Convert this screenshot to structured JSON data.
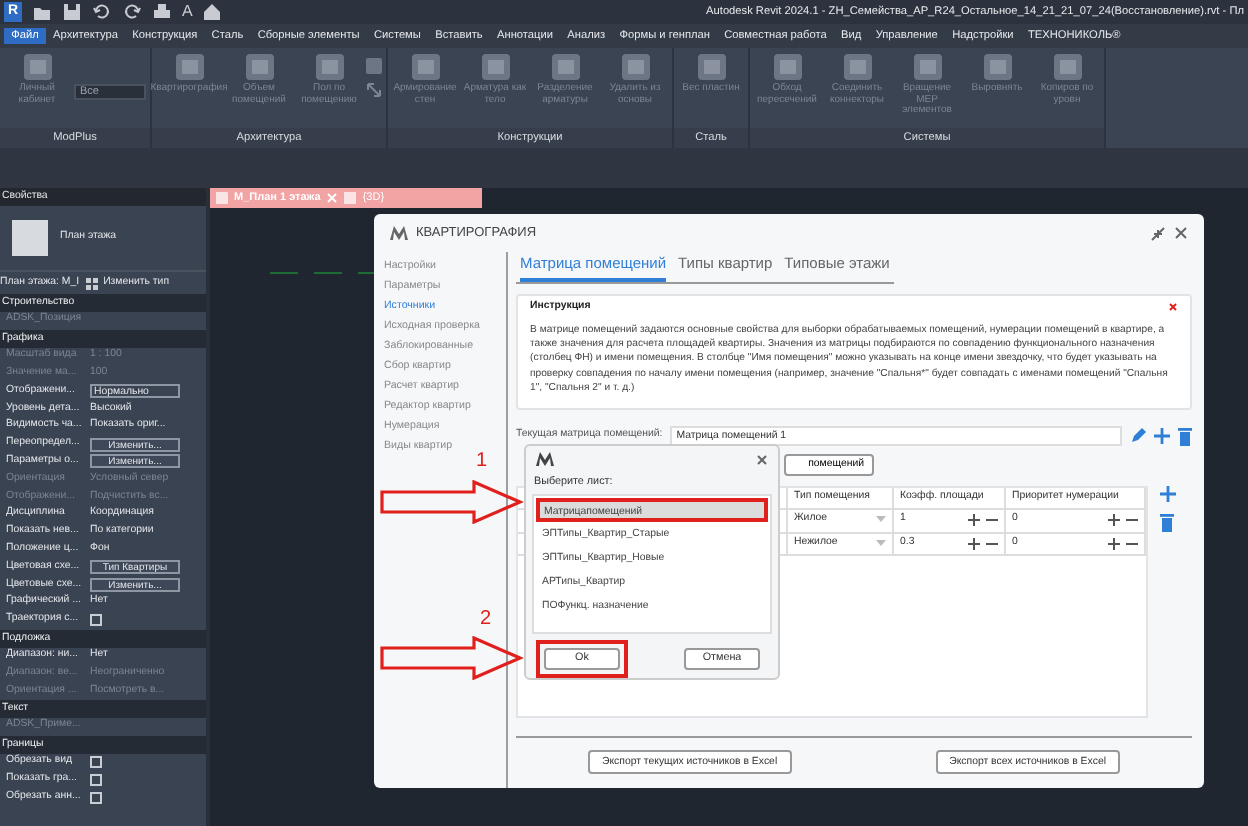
{
  "title_bar": {
    "logo": "R",
    "text_tool": "A",
    "title": "Autodesk Revit 2024.1 - ZH_Семейства_АР_R24_Остальное_14_21_21_07_24(Восстановление).rvt - Пл"
  },
  "menu": [
    {
      "label": "Файл",
      "selected": true
    },
    {
      "label": "Архитектура",
      "selected": false
    },
    {
      "label": "Конструкция",
      "selected": false
    },
    {
      "label": "Сталь",
      "selected": false
    },
    {
      "label": "Сборные элементы",
      "selected": false
    },
    {
      "label": "Системы",
      "selected": false
    },
    {
      "label": "Вставить",
      "selected": false
    },
    {
      "label": "Аннотации",
      "selected": false
    },
    {
      "label": "Анализ",
      "selected": false
    },
    {
      "label": "Формы и генплан",
      "selected": false
    },
    {
      "label": "Совместная работа",
      "selected": false
    },
    {
      "label": "Вид",
      "selected": false
    },
    {
      "label": "Управление",
      "selected": false
    },
    {
      "label": "Надстройки",
      "selected": false
    },
    {
      "label": "ТЕХНОНИКОЛЬ®",
      "selected": false
    }
  ],
  "ribbon": [
    {
      "title": "ModPlus",
      "tools": [
        {
          "kind": "large",
          "label": "Личный кабинет"
        },
        {
          "kind": "combo",
          "label": "Все"
        }
      ]
    },
    {
      "title": "Архитектура",
      "tools": [
        {
          "kind": "large",
          "label": "Квартирография"
        },
        {
          "kind": "large",
          "label": "Объем помещений"
        },
        {
          "kind": "large",
          "label": "Пол по помещению"
        },
        {
          "kind": "small"
        }
      ]
    },
    {
      "title": "Конструкции",
      "tools": [
        {
          "kind": "large",
          "label": "Армирование стен"
        },
        {
          "kind": "large",
          "label": "Арматура как тело"
        },
        {
          "kind": "large",
          "label": "Разделение арматуры"
        },
        {
          "kind": "large",
          "label": "Удалить из основы"
        }
      ]
    },
    {
      "title": "Сталь",
      "tools": [
        {
          "kind": "large",
          "label": "Вес пластин"
        }
      ]
    },
    {
      "title": "Системы",
      "tools": [
        {
          "kind": "large",
          "label": "Обход пересечений"
        },
        {
          "kind": "large",
          "label": "Соединить коннекторы"
        },
        {
          "kind": "large",
          "label": "Вращение MEP элементов"
        },
        {
          "kind": "large",
          "label": "Выровнять"
        },
        {
          "kind": "large",
          "label": "Копиров по уровн"
        }
      ]
    }
  ],
  "properties": {
    "title": "Свойства",
    "type_name": "План этажа",
    "view_selector": "План этажа: M_I",
    "edit_type": "Изменить тип",
    "groups": [
      {
        "title": "Строительство",
        "rows": [
          {
            "kind": "text",
            "label": "ADSK_Позиция",
            "disabled": true
          }
        ]
      },
      {
        "title": "Графика",
        "rows": [
          {
            "kind": "text",
            "label": "Масштаб вида",
            "value": "1 : 100",
            "disabled": true
          },
          {
            "kind": "text",
            "label": "Значение ма...",
            "value": "100",
            "disabled": true
          },
          {
            "kind": "field",
            "label": "Отображени...",
            "value": "Нормально",
            "disabled": false
          },
          {
            "kind": "text",
            "label": "Уровень дета...",
            "value": "Высокий",
            "disabled": false
          },
          {
            "kind": "text",
            "label": "Видимость ча...",
            "value": "Показать ориг...",
            "disabled": false
          },
          {
            "kind": "button",
            "label": "Переопредел...",
            "value": "Изменить...",
            "disabled": false
          },
          {
            "kind": "button",
            "label": "Параметры о...",
            "value": "Изменить...",
            "disabled": false
          },
          {
            "kind": "text",
            "label": "Ориентация",
            "value": "Условный север",
            "disabled": true
          },
          {
            "kind": "text",
            "label": "Отображени...",
            "value": "Подчистить вс...",
            "disabled": true
          },
          {
            "kind": "text",
            "label": "Дисциплина",
            "value": "Координация",
            "disabled": false
          },
          {
            "kind": "text",
            "label": "Показать нев...",
            "value": "По категории",
            "disabled": false
          },
          {
            "kind": "text",
            "label": "Положение ц...",
            "value": "Фон",
            "disabled": false
          },
          {
            "kind": "button",
            "label": "Цветовая схе...",
            "value": "Тип Квартиры",
            "disabled": false
          },
          {
            "kind": "button",
            "label": "Цветовые схе...",
            "value": "Изменить...",
            "disabled": false
          },
          {
            "kind": "text",
            "label": "Графический ...",
            "value": "Нет",
            "disabled": false
          },
          {
            "kind": "check",
            "label": "Траектория с...",
            "checked": false,
            "disabled": false
          }
        ]
      },
      {
        "title": "Подложка",
        "rows": [
          {
            "kind": "text",
            "label": "Диапазон: ни...",
            "value": "Нет",
            "disabled": false
          },
          {
            "kind": "text",
            "label": "Диапазон: ве...",
            "value": "Неограниченно",
            "disabled": true
          },
          {
            "kind": "text",
            "label": "Ориентация ...",
            "value": "Посмотреть в...",
            "disabled": true
          }
        ]
      },
      {
        "title": "Текст",
        "rows": [
          {
            "kind": "text",
            "label": "ADSK_Приме...",
            "disabled": true
          }
        ]
      },
      {
        "title": "Границы",
        "rows": [
          {
            "kind": "check",
            "label": "Обрезать вид",
            "checked": false,
            "disabled": false
          },
          {
            "kind": "check",
            "label": "Показать гра...",
            "checked": false,
            "disabled": false
          },
          {
            "kind": "check",
            "label": "Обрезать анн...",
            "checked": false,
            "disabled": false
          }
        ]
      }
    ]
  },
  "view_tabs": [
    {
      "label": "M_План 1 этажа",
      "selected": true
    },
    {
      "label": "{3D}",
      "selected": false
    }
  ],
  "dialog": {
    "title": "КВАРТИРОГРАФИЯ",
    "nav": [
      {
        "label": "Настройки",
        "selected": false
      },
      {
        "label": "Параметры",
        "selected": false
      },
      {
        "label": "Источники",
        "selected": true
      },
      {
        "label": "Исходная проверка",
        "selected": false
      },
      {
        "label": "Заблокированные",
        "selected": false
      },
      {
        "label": "Сбор квартир",
        "selected": false
      },
      {
        "label": "Расчет квартир",
        "selected": false
      },
      {
        "label": "Редактор квартир",
        "selected": false
      },
      {
        "label": "Нумерация",
        "selected": false
      },
      {
        "label": "Виды квартир",
        "selected": false
      }
    ],
    "tabs": [
      {
        "label": "Матрица помещений",
        "selected": true
      },
      {
        "label": "Типы квартир",
        "selected": false
      },
      {
        "label": "Типовые этажи",
        "selected": false
      }
    ],
    "instruction": {
      "title": "Инструкция",
      "text": "В матрице помещений задаются основные свойства для выборки обрабатываемых помещений, нумерации помещений в квартире, а также значения для расчета площадей квартиры. Значения из матрицы подбираются по совпадению функционального назначения (столбец ФН) и имени помещения. В столбце \"Имя помещения\" можно указывать на конце имени звездочку, что будет указывать на проверку совпадения по началу имени помещения (например, значение \"Спальня*\" будет совпадать с именами помещений \"Спальня 1\", \"Спальня 2\" и т. д.)"
    },
    "matrix_label": "Текущая матрица помещений:",
    "matrix_value": "Матрица помещений 1",
    "partial_button": "помещений",
    "table": {
      "columns": [
        "Тип помещения",
        "Коэфф. площади",
        "Приоритет нумерации"
      ],
      "rows": [
        {
          "room_type": "Жилое",
          "area_factor": "1",
          "priority": "0"
        },
        {
          "room_type": "Нежилое",
          "area_factor": "0.3",
          "priority": "0"
        }
      ]
    },
    "export_buttons": [
      "Экспорт текущих источников в Excel",
      "Экспорт всех источников в Excel"
    ]
  },
  "sheet_picker": {
    "prompt": "Выберите лист:",
    "items": [
      {
        "label": "Матрицапомещений",
        "selected": true
      },
      {
        "label": "ЭПТипы_Квартир_Старые",
        "selected": false
      },
      {
        "label": "ЭПТипы_Квартир_Новые",
        "selected": false
      },
      {
        "label": "АРТипы_Квартир",
        "selected": false
      },
      {
        "label": "ПОФункц. назначение",
        "selected": false
      }
    ],
    "ok": "Ok",
    "cancel": "Отмена"
  },
  "annotations": [
    {
      "label": "1"
    },
    {
      "label": "2"
    }
  ]
}
